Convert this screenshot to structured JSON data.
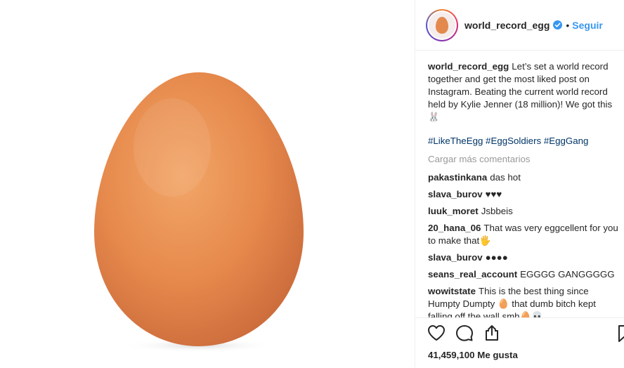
{
  "post": {
    "username": "world_record_egg",
    "follow_label": "Seguir",
    "separator": "•",
    "caption": {
      "username": "world_record_egg",
      "text": "Let’s set a world record together and get the most liked post on Instagram. Beating the current world record held by Kylie Jenner (18 million)! We got this 🐰",
      "hashtags": "#LikeTheEgg #EggSoldiers #EggGang"
    },
    "load_more_label": "Cargar más comentarios",
    "comments": [
      {
        "user": "pakastinkana",
        "text": "das hot"
      },
      {
        "user": "slava_burov",
        "text": "♥♥♥"
      },
      {
        "user": "luuk_moret",
        "text": "Jsbbeis"
      },
      {
        "user": "20_hana_06",
        "text": "That was very eggcellent for you to make that🖐"
      },
      {
        "user": "slava_burov",
        "text": "●●●●"
      },
      {
        "user": "seans_real_account",
        "text": "EGGGG GANGGGGG"
      },
      {
        "user": "wowitstate",
        "text": "This is the best thing since Humpty Dumpty 🥚 that dumb bitch kept falling off the wall smh🥚💀"
      }
    ],
    "likes_label": "41,459,100 Me gusta"
  },
  "icons": {
    "verified": "verified-badge-icon",
    "like": "heart-icon",
    "comment": "comment-bubble-icon",
    "share": "share-icon",
    "save": "bookmark-icon"
  },
  "colors": {
    "link": "#3897f0",
    "hashtag": "#003569",
    "muted": "#999999",
    "egg": "#e8904f"
  }
}
